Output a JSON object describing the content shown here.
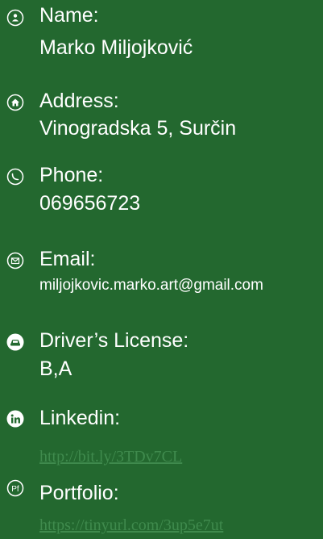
{
  "colors": {
    "background": "#23682f",
    "text": "#ffffff",
    "link": "#3f8a4d"
  },
  "contact": {
    "name": {
      "icon": "person-icon",
      "label": "Name:",
      "value": "Marko Miljojković"
    },
    "address": {
      "icon": "home-icon",
      "label": "Address:",
      "value": "Vinogradska 5, Surčin"
    },
    "phone": {
      "icon": "phone-icon",
      "label": "Phone:",
      "value": "069656723"
    },
    "email": {
      "icon": "envelope-icon",
      "label": "Email:",
      "value": "miljojkovic.marko.art@gmail.com"
    },
    "license": {
      "icon": "car-icon",
      "label": "Driver’s License:",
      "value": "B,A"
    },
    "linkedin": {
      "icon": "linkedin-icon",
      "label": "Linkedin:",
      "value": "http://bit.ly/3TDv7CL"
    },
    "portfolio": {
      "icon": "portfolio-pf-icon",
      "label": "Portfolio:",
      "value": "https://tinyurl.com/3up5e7ut"
    }
  }
}
